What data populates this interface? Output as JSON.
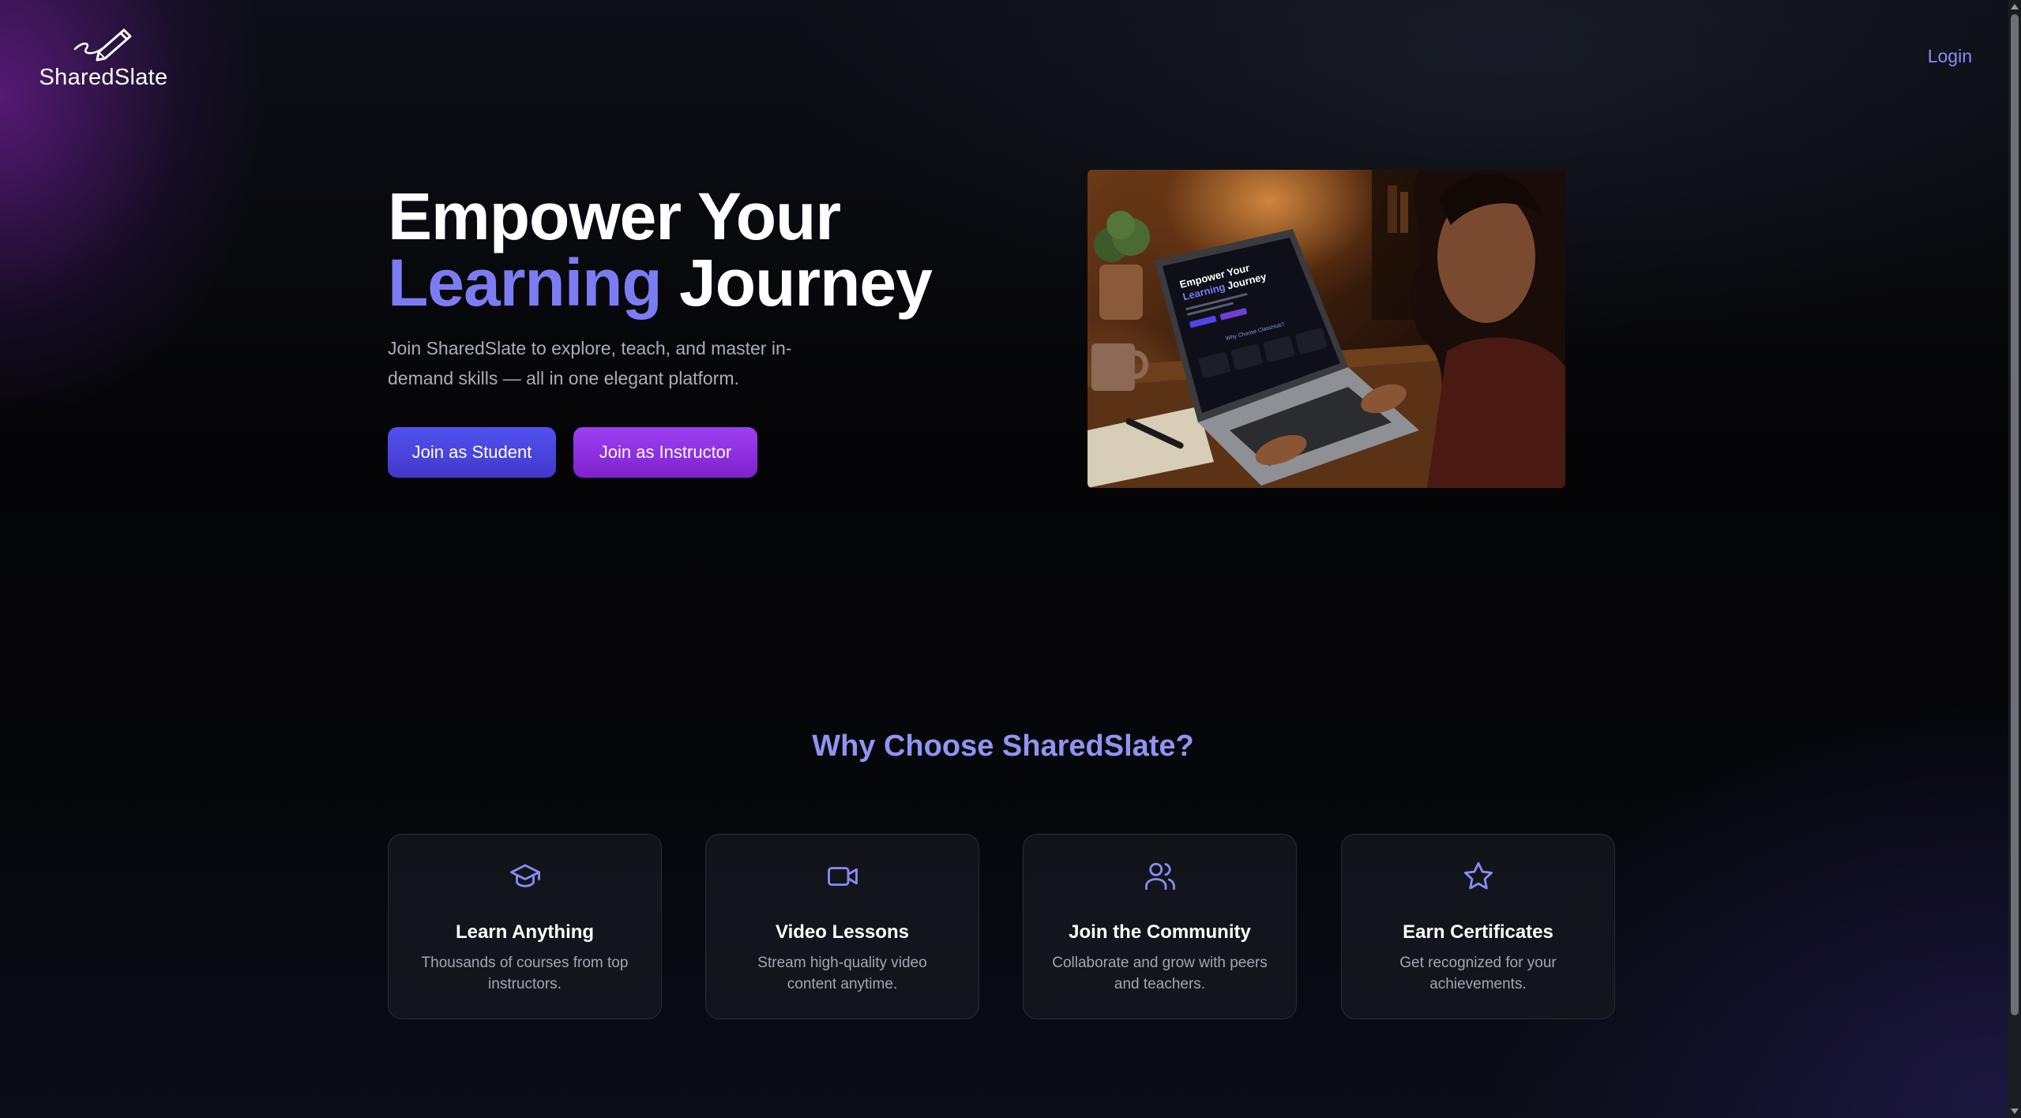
{
  "header": {
    "brand": "SharedSlate",
    "login_label": "Login"
  },
  "hero": {
    "title_line1": "Empower Your",
    "title_accent": "Learning",
    "title_line2_rest": "Journey",
    "subtitle": "Join SharedSlate to explore, teach, and master in-demand skills — all in one elegant platform.",
    "student_button": "Join as Student",
    "instructor_button": "Join as Instructor",
    "image_alt": "Person using a laptop showing the SharedSlate homepage",
    "screen": {
      "title_line1": "Empower Your",
      "title_accent": "Learning",
      "title_rest": "Journey",
      "section": "Why Choose ClassHub?"
    }
  },
  "features": {
    "title": "Why Choose SharedSlate?",
    "cards": [
      {
        "icon": "graduation-cap-icon",
        "title": "Learn Anything",
        "desc": "Thousands of courses from top instructors."
      },
      {
        "icon": "video-camera-icon",
        "title": "Video Lessons",
        "desc": "Stream high-quality video content anytime."
      },
      {
        "icon": "users-icon",
        "title": "Join the Community",
        "desc": "Collaborate and grow with peers and teachers."
      },
      {
        "icon": "star-icon",
        "title": "Earn Certificates",
        "desc": "Get recognized for your achievements."
      }
    ]
  },
  "colors": {
    "accent": "#7c7cf2",
    "section_title": "#8f94f2",
    "student_button": "#4f46e5",
    "instructor_button": "#9333ea",
    "login_link": "#8b8cf6"
  }
}
